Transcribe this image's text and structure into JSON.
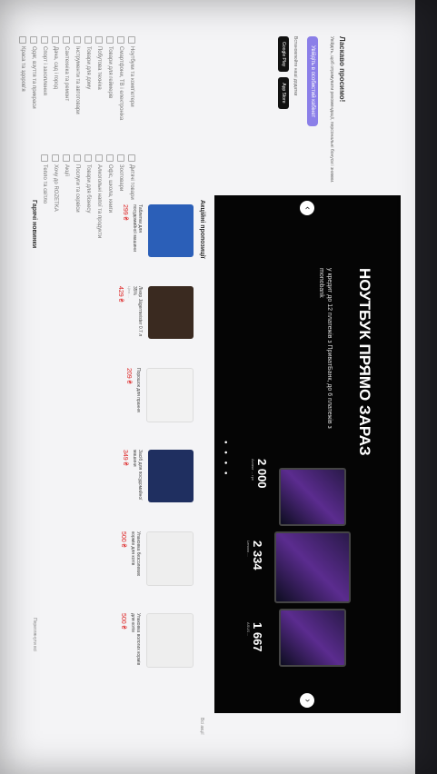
{
  "banner": {
    "title": "НОУТБУК ПРЯМО ЗАРАЗ",
    "subtitle": "у кредит до 12 платежів з ПриватБанк, до 6 платежів з monobank",
    "prices": [
      {
        "big": "2 000",
        "small": "Аспект ... грн"
      },
      {
        "big": "2 334",
        "small": "Lenovo ..."
      },
      {
        "big": "1 667",
        "small": "ASUS ..."
      }
    ]
  },
  "sidebar": {
    "items_col1": [
      "Ноутбуки та комп'ютери",
      "Смартфони, ТВ і електроніка",
      "Товари для геймерів",
      "Побутова техніка",
      "Товари для дому",
      "Інструменти та автотовари",
      "Сантехніка та ремонт",
      "Дача, сад і город",
      "Спорт і захоплення",
      "Одяг, взуття та прикраси",
      "Краса та здоров'я"
    ],
    "items_col2": [
      "Дитячі товари",
      "Зоотовари",
      "Офіс, школа, книги",
      "Алкогольні напої та продукти",
      "Товари для бізнесу",
      "Послуги та сервіси",
      "Акції",
      "Хочу до ROZETKA",
      "Тепло та світло"
    ]
  },
  "promo": {
    "title": "Ласкаво просимо!",
    "text": "Увійдіть, щоб отримувати рекомендації, персональні бонуси і знижки.",
    "button": "Увійдіть в особистий кабінет",
    "apps_label": "Встановлюйте наші додатки",
    "app1": "Google Play",
    "app2": "App Store"
  },
  "products_title": "Акційні пропозиції",
  "all_link": "Всі акції",
  "products": [
    {
      "name": "Таблетки для посудомийної машини",
      "price": "299 ₴",
      "old": "",
      "color": "#2b5fb8"
    },
    {
      "name": "Лікер Jägermeister 0.7 л 35%",
      "price": "429 ₴",
      "old": "Ціна ...",
      "color": "#3a2a20"
    },
    {
      "name": "Порошок для прання",
      "price": "209 ₴",
      "old": "",
      "color": "#f2f2f2"
    },
    {
      "name": "Засіб для посудомийної машини",
      "price": "349 ₴",
      "old": "",
      "color": "#1f2f60"
    },
    {
      "name": "Упаковка безсолевих кормів для котів",
      "price": "500 ₴",
      "old": "",
      "color": "#eeeeee"
    },
    {
      "name": "Упаковка вологих кормів для котів",
      "price": "500 ₴",
      "old": "",
      "color": "#eeeeee"
    }
  ],
  "novelties": "Гарячі новинки",
  "view_all": "Переглянути всі"
}
